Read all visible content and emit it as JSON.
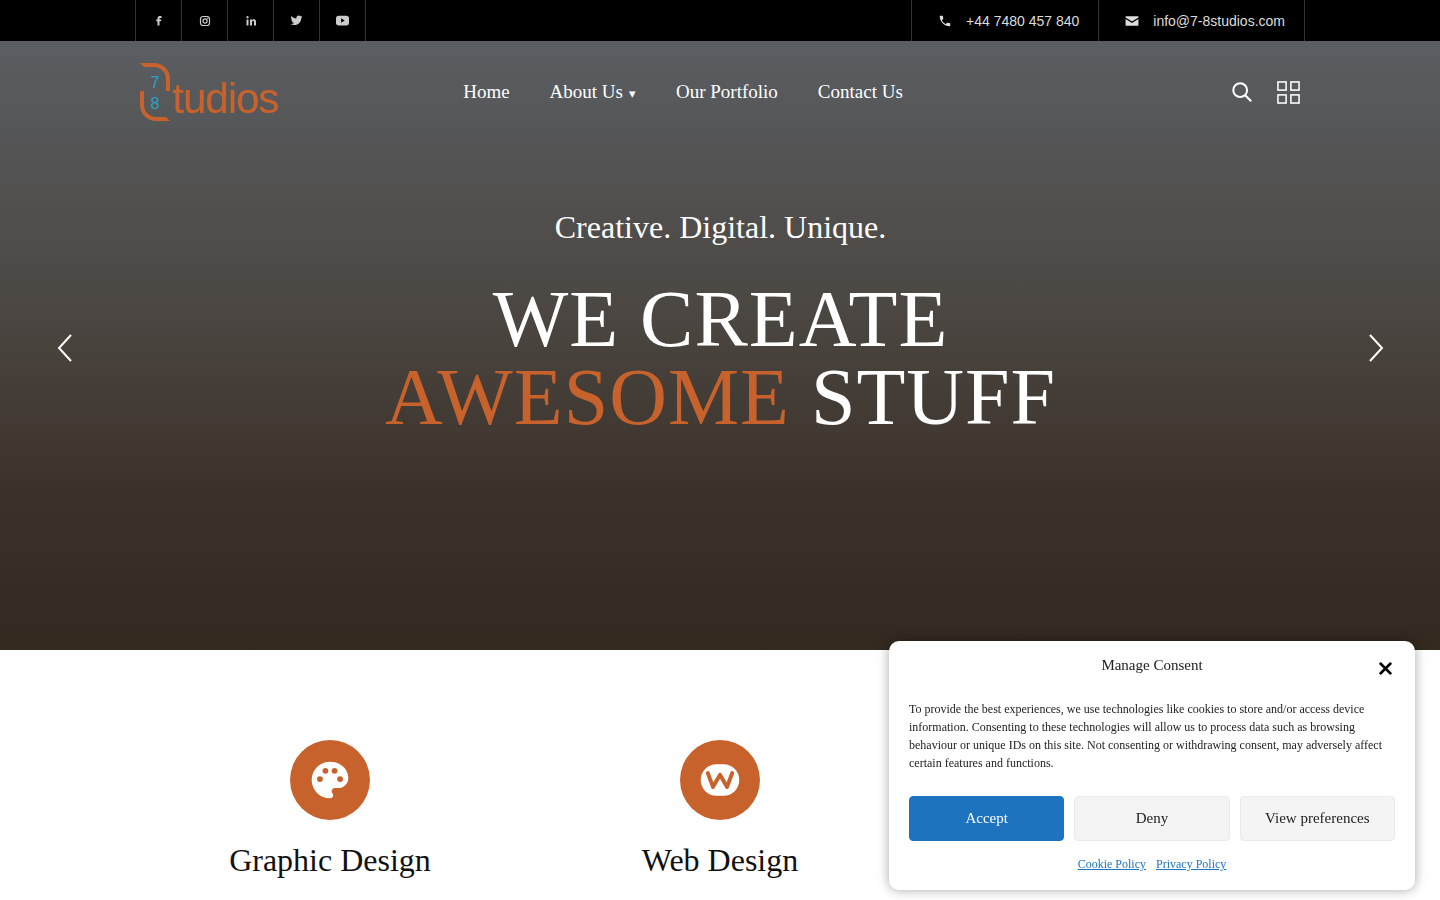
{
  "topbar": {
    "phone": "+44 7480 457 840",
    "email": "info@7-8studios.com"
  },
  "logo": {
    "top": "7",
    "bottom": "8",
    "word": "tudios"
  },
  "nav": [
    {
      "label": "Home",
      "caret": ""
    },
    {
      "label": "About Us",
      "caret": "▾"
    },
    {
      "label": "Our Portfolio",
      "caret": ""
    },
    {
      "label": "Contact Us",
      "caret": ""
    }
  ],
  "hero": {
    "tagline": "Creative. Digital. Unique.",
    "line1": "WE CREATE",
    "highlight": "AWESOME",
    "rest": "STUFF"
  },
  "services": [
    {
      "title": "Graphic Design",
      "kind": "palette"
    },
    {
      "title": "Web Design",
      "kind": "web"
    }
  ],
  "consent": {
    "title": "Manage Consent",
    "text": "To provide the best experiences, we use technologies like cookies to store and/or access device information. Consenting to these technologies will allow us to process data such as browsing behaviour or unique IDs on this site. Not consenting or withdrawing consent, may adversely affect certain features and functions.",
    "buttons": [
      {
        "label": "Accept",
        "primary": true
      },
      {
        "label": "Deny",
        "primary": false
      },
      {
        "label": "View preferences",
        "primary": false
      }
    ],
    "links": [
      "Cookie Policy",
      "Privacy Policy"
    ]
  }
}
